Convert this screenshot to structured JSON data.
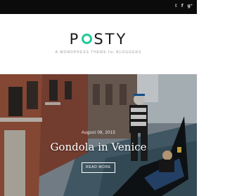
{
  "topbar": {
    "social_icons": [
      {
        "name": "twitter-icon",
        "glyph": "𝕥"
      },
      {
        "name": "facebook-icon",
        "glyph": "f"
      },
      {
        "name": "google-plus-icon",
        "glyph": "g⁺"
      }
    ]
  },
  "header": {
    "logo_before": "P",
    "logo_after": "STY",
    "tagline": "A WORDPRESS THEME for BLOGGERS",
    "accent_color": "#20c997"
  },
  "hero": {
    "date": "August 08, 2015",
    "title": "Gondola in Venice",
    "button_label": "READ MORE"
  }
}
